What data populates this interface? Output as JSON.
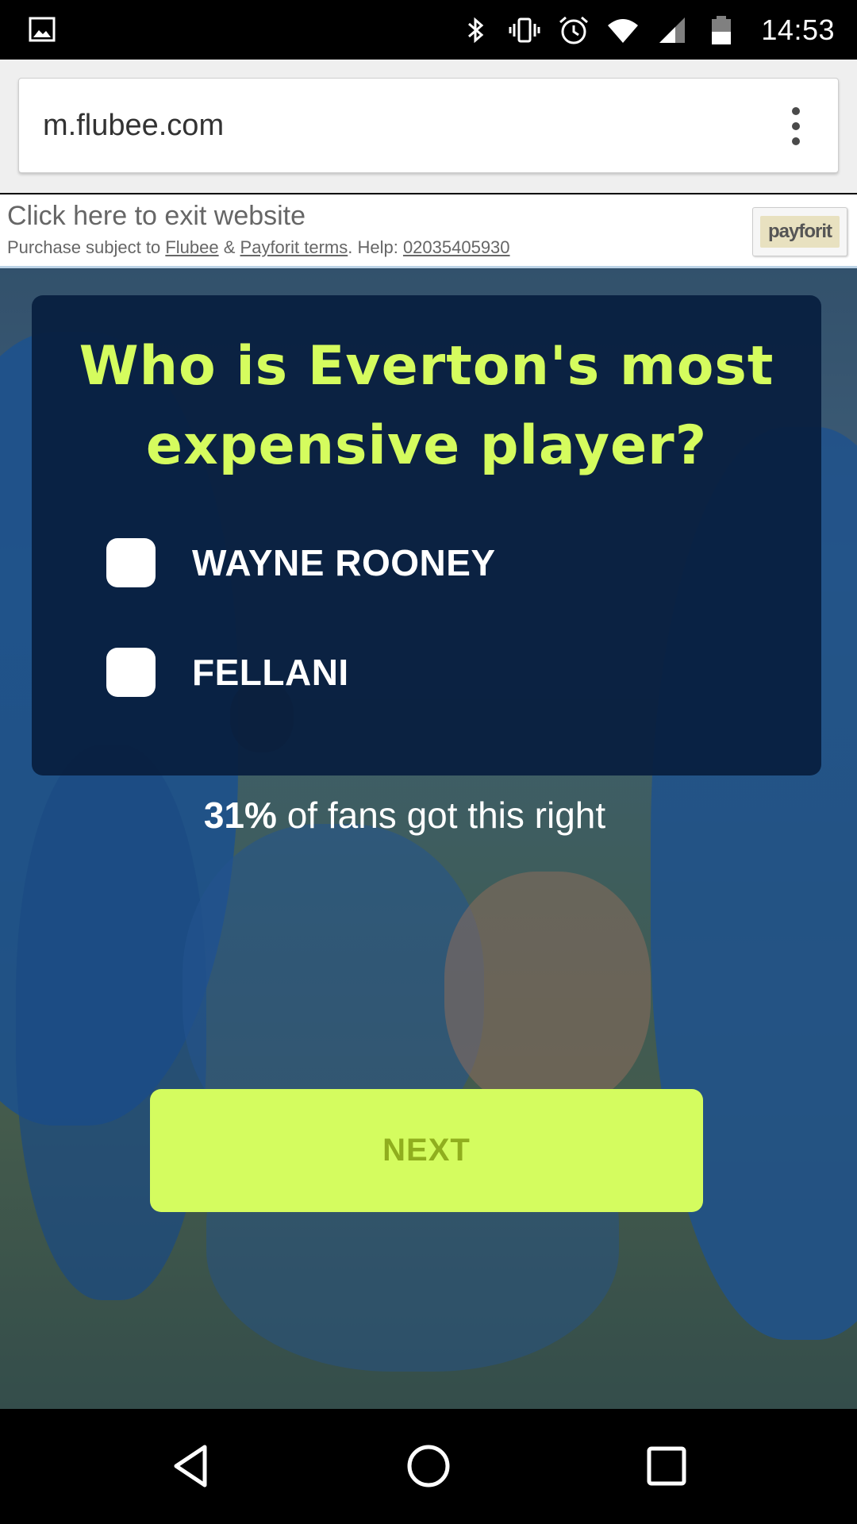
{
  "status_bar": {
    "time": "14:53",
    "icons": [
      "image-icon",
      "bluetooth-icon",
      "vibrate-icon",
      "alarm-icon",
      "wifi-icon",
      "signal-icon",
      "battery-icon"
    ]
  },
  "browser": {
    "url": "m.flubee.com",
    "menu_icon": "overflow-menu-icon"
  },
  "exit_banner": {
    "title": "Click here to exit website",
    "terms_prefix": "Purchase subject to ",
    "flubee_link": "Flubee",
    "amp": " & ",
    "payforit_link": "Payforit terms",
    "help_prefix": ". Help: ",
    "phone": "02035405930",
    "logo_text": "payforit"
  },
  "quiz": {
    "question_line1": "Who is Everton's most",
    "question_line2": "expensive player?",
    "options": [
      {
        "label": "WAYNE ROONEY",
        "checked": false
      },
      {
        "label": "FELLANI",
        "checked": false
      }
    ],
    "stat_percent": "31%",
    "stat_text": " of fans got this right",
    "next_label": "NEXT"
  },
  "colors": {
    "accent": "#d4fc5f",
    "card": "#081e3e",
    "question_text": "#d5fc5e",
    "button_text": "#90ae1e"
  },
  "nav_bar": {
    "icons": [
      "back-icon",
      "home-icon",
      "recents-icon"
    ]
  }
}
